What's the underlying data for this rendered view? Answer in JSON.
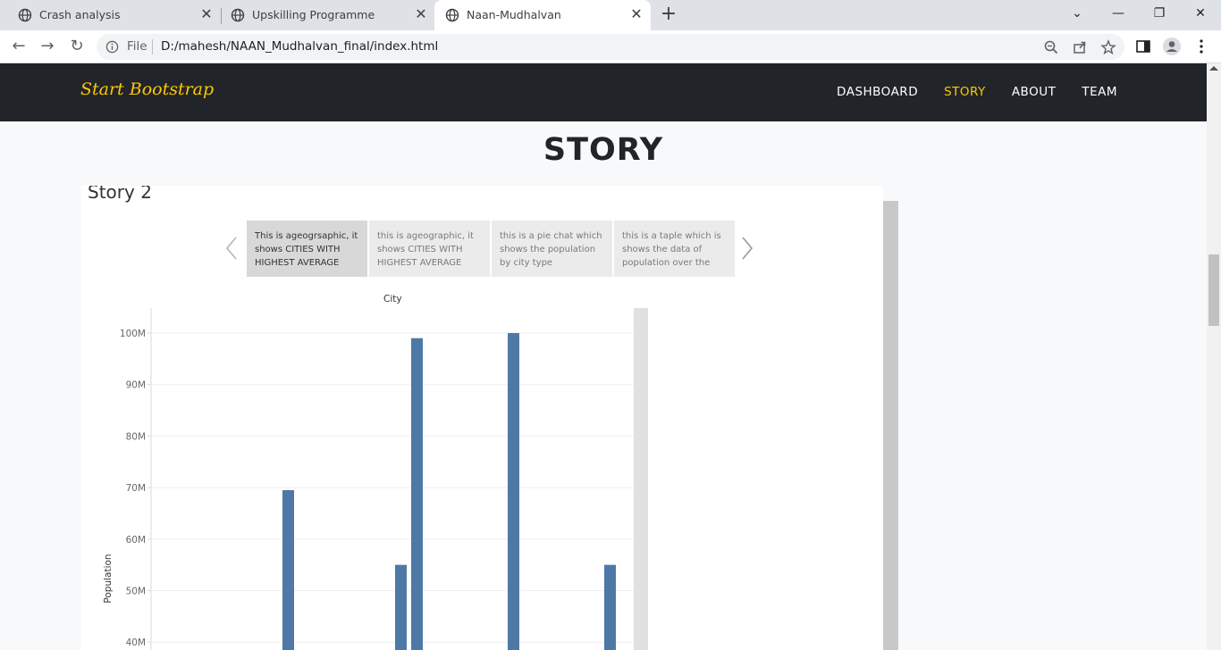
{
  "browser": {
    "tabs": [
      {
        "title": "Crash analysis",
        "active": false
      },
      {
        "title": "Upskilling Programme",
        "active": false
      },
      {
        "title": "Naan-Mudhalvan",
        "active": true
      }
    ],
    "address": {
      "scheme_label": "File",
      "url": "D:/mahesh/NAAN_Mudhalvan_final/index.html"
    }
  },
  "navbar": {
    "brand": "Start Bootstrap",
    "links": [
      {
        "label": "DASHBOARD",
        "active": false
      },
      {
        "label": "STORY",
        "active": true
      },
      {
        "label": "ABOUT",
        "active": false
      },
      {
        "label": "TEAM",
        "active": false
      }
    ],
    "accent_color": "#ffc800",
    "background_color": "#212529"
  },
  "page": {
    "title": "STORY"
  },
  "story": {
    "title": "Story 2",
    "points": [
      {
        "text": "This is ageogrsaphic, it shows CITIES WITH HIGHEST AVERAGE",
        "active": true
      },
      {
        "text": "this is ageographic, it shows CITIES WITH HIGHEST AVERAGE",
        "active": false
      },
      {
        "text": "this is a pie chat which shows the population by city type",
        "active": false
      },
      {
        "text": "this is a taple which is shows the data of population over the",
        "active": false
      }
    ]
  },
  "chart_data": {
    "type": "bar",
    "header": "City",
    "ylabel": "Population",
    "ylim": [
      37000000,
      105000000
    ],
    "yticks": [
      40000000,
      50000000,
      60000000,
      70000000,
      80000000,
      90000000,
      100000000
    ],
    "ytick_labels": [
      "40M",
      "50M",
      "60M",
      "70M",
      "80M",
      "90M",
      "100M"
    ],
    "grid": true,
    "bar_color": "#4e79a7",
    "values": [
      69500000,
      55000000,
      99000000,
      100000000,
      55000000
    ]
  }
}
